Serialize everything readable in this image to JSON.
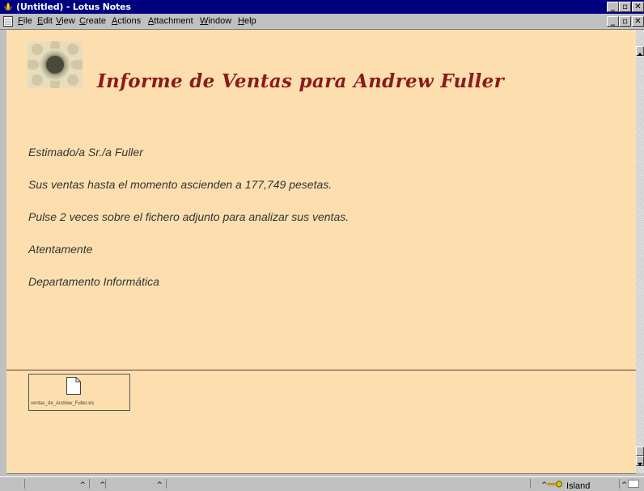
{
  "window": {
    "title": "(Untitled) - Lotus Notes",
    "min_glyph": "_",
    "max_glyph": "▫",
    "close_glyph": "✕",
    "icon": "lotus-notes-icon"
  },
  "menu": {
    "items": [
      "File",
      "Edit",
      "View",
      "Create",
      "Actions",
      "Attachment",
      "Window",
      "Help"
    ]
  },
  "document": {
    "heading": "Informe de Ventas para Andrew Fuller",
    "paragraphs": [
      "Estimado/a Sr./a Fuller",
      "Sus ventas hasta el momento ascienden a 177,749 pesetas.",
      "Pulse 2 veces sobre el fichero adjunto para analizar sus ventas.",
      "Atentamente",
      "Departamento Informática"
    ],
    "attachment": {
      "filename": "ventas_de_Andrew_Fuller.xls"
    },
    "colors": {
      "background": "#fddfaf",
      "heading": "#8b1a1a"
    }
  },
  "statusbar": {
    "location": "Island"
  }
}
